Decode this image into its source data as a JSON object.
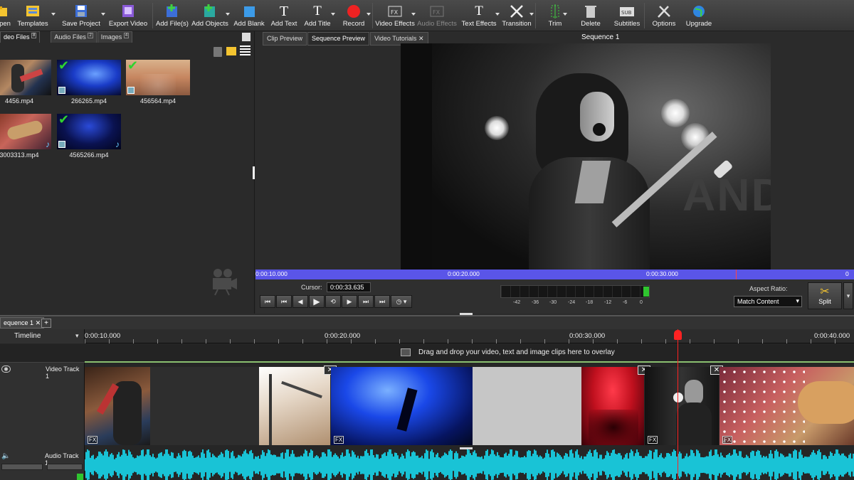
{
  "toolbar": {
    "items": [
      {
        "label": "pen"
      },
      {
        "label": "Templates"
      },
      {
        "label": "Save Project"
      },
      {
        "label": "Export Video"
      },
      {
        "label": "Add File(s)"
      },
      {
        "label": "Add Objects"
      },
      {
        "label": "Add Blank"
      },
      {
        "label": "Add Text"
      },
      {
        "label": "Add Title"
      },
      {
        "label": "Record"
      },
      {
        "label": "Video Effects"
      },
      {
        "label": "Audio Effects"
      },
      {
        "label": "Text Effects"
      },
      {
        "label": "Transition"
      },
      {
        "label": "Trim"
      },
      {
        "label": "Delete"
      },
      {
        "label": "Subtitles"
      },
      {
        "label": "Options"
      },
      {
        "label": "Upgrade"
      }
    ]
  },
  "media_bin": {
    "tabs": [
      {
        "label": "deo Files",
        "badge": "8"
      },
      {
        "label": "Audio Files",
        "badge": "2"
      },
      {
        "label": "Images",
        "badge": "4"
      }
    ],
    "files": [
      {
        "name": "4456.mp4"
      },
      {
        "name": "266265.mp4"
      },
      {
        "name": "456564.mp4"
      },
      {
        "name": "3003313.mp4"
      },
      {
        "name": "4565266.mp4"
      }
    ]
  },
  "preview": {
    "tabs": [
      {
        "label": "Clip Preview"
      },
      {
        "label": "Sequence Preview"
      },
      {
        "label": "Video Tutorials"
      }
    ],
    "sequence_title": "Sequence 1",
    "video_text": "ANDY",
    "ruler_labels": [
      "0:00:10.000",
      "0:00:20.000",
      "0:00:30.000",
      "0"
    ],
    "cursor_label": "Cursor:",
    "cursor_value": "0:00:33.635",
    "meter_labels": [
      "-42",
      "-36",
      "-30",
      "-24",
      "-18",
      "-12",
      "-6",
      "0"
    ],
    "aspect_label": "Aspect Ratio:",
    "aspect_value": "Match Content",
    "split_label": "Split"
  },
  "timeline": {
    "sequence_tab": "equence 1",
    "mode_label": "Timeline",
    "ruler_labels": [
      "0:00:10.000",
      "0:00:20.000",
      "0:00:30.000",
      "0:00:40.000"
    ],
    "overlay_hint": "Drag and drop your video, text and image clips here to overlay",
    "video_track_label": "Video Track 1",
    "audio_track_label": "Audio Track 1",
    "fx_label": "FX"
  }
}
